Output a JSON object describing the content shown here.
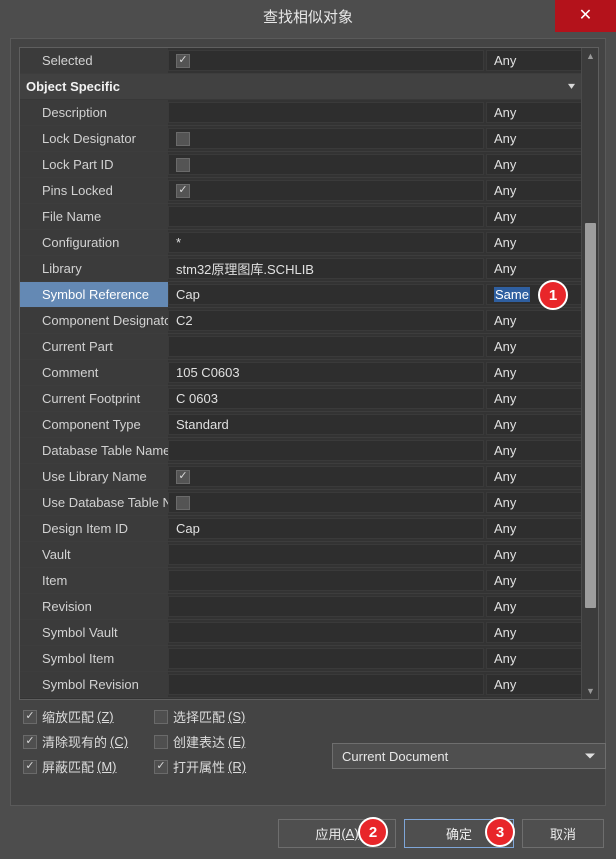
{
  "window": {
    "title": "查找相似对象",
    "close_label": "✕"
  },
  "grid": {
    "group_header": "Object Specific",
    "rows": [
      {
        "label": "Selected",
        "type": "checkbox",
        "checked": true,
        "value": "",
        "condition": "Any"
      },
      {
        "label": "Description",
        "type": "text",
        "value": "",
        "condition": "Any"
      },
      {
        "label": "Lock Designator",
        "type": "checkbox",
        "checked": false,
        "value": "",
        "condition": "Any"
      },
      {
        "label": "Lock Part ID",
        "type": "checkbox",
        "checked": false,
        "value": "",
        "condition": "Any"
      },
      {
        "label": "Pins Locked",
        "type": "checkbox",
        "checked": true,
        "value": "",
        "condition": "Any"
      },
      {
        "label": "File Name",
        "type": "text",
        "value": "",
        "condition": "Any"
      },
      {
        "label": "Configuration",
        "type": "text",
        "value": "*",
        "condition": "Any"
      },
      {
        "label": "Library",
        "type": "text",
        "value": "stm32原理图库.SCHLIB",
        "condition": "Any"
      },
      {
        "label": "Symbol Reference",
        "type": "text",
        "value": "Cap",
        "condition": "Same",
        "selected": true
      },
      {
        "label": "Component Designator",
        "type": "text",
        "value": "C2",
        "condition": "Any"
      },
      {
        "label": "Current Part",
        "type": "text",
        "value": "",
        "condition": "Any"
      },
      {
        "label": "Comment",
        "type": "text",
        "value": "105 C0603",
        "condition": "Any"
      },
      {
        "label": "Current Footprint",
        "type": "text",
        "value": "C 0603",
        "condition": "Any"
      },
      {
        "label": "Component Type",
        "type": "text",
        "value": "Standard",
        "condition": "Any"
      },
      {
        "label": "Database Table Name",
        "type": "text",
        "value": "",
        "condition": "Any"
      },
      {
        "label": "Use Library Name",
        "type": "checkbox",
        "checked": true,
        "value": "",
        "condition": "Any"
      },
      {
        "label": "Use Database Table Nar",
        "type": "checkbox",
        "checked": false,
        "value": "",
        "condition": "Any"
      },
      {
        "label": "Design Item ID",
        "type": "text",
        "value": "Cap",
        "condition": "Any"
      },
      {
        "label": "Vault",
        "type": "text",
        "value": "",
        "condition": "Any"
      },
      {
        "label": "Item",
        "type": "text",
        "value": "",
        "condition": "Any"
      },
      {
        "label": "Revision",
        "type": "text",
        "value": "",
        "condition": "Any"
      },
      {
        "label": "Symbol Vault",
        "type": "text",
        "value": "",
        "condition": "Any"
      },
      {
        "label": "Symbol Item",
        "type": "text",
        "value": "",
        "condition": "Any"
      },
      {
        "label": "Symbol Revision",
        "type": "text",
        "value": "",
        "condition": "Any"
      }
    ],
    "group_row_index": 1
  },
  "options": [
    {
      "label": "缩放匹配",
      "accel": "(Z)",
      "checked": true
    },
    {
      "label": "选择匹配",
      "accel": "(S)",
      "checked": false
    },
    {
      "label": "清除现有的",
      "accel": "(C)",
      "checked": true
    },
    {
      "label": "创建表达",
      "accel": "(E)",
      "checked": false
    },
    {
      "label": "屏蔽匹配",
      "accel": "(M)",
      "checked": true
    },
    {
      "label": "打开属性",
      "accel": "(R)",
      "checked": true
    }
  ],
  "scope": {
    "selected": "Current Document"
  },
  "footer": {
    "apply_label": "应用 ",
    "apply_accel": "(A)",
    "ok_label": "确定",
    "cancel_label": "取消"
  },
  "annotations": [
    {
      "id": "1"
    },
    {
      "id": "2"
    },
    {
      "id": "3"
    }
  ],
  "colors": {
    "accent_red": "#e8262a",
    "selection_blue": "#6489b4",
    "close_red": "#b4121b"
  }
}
